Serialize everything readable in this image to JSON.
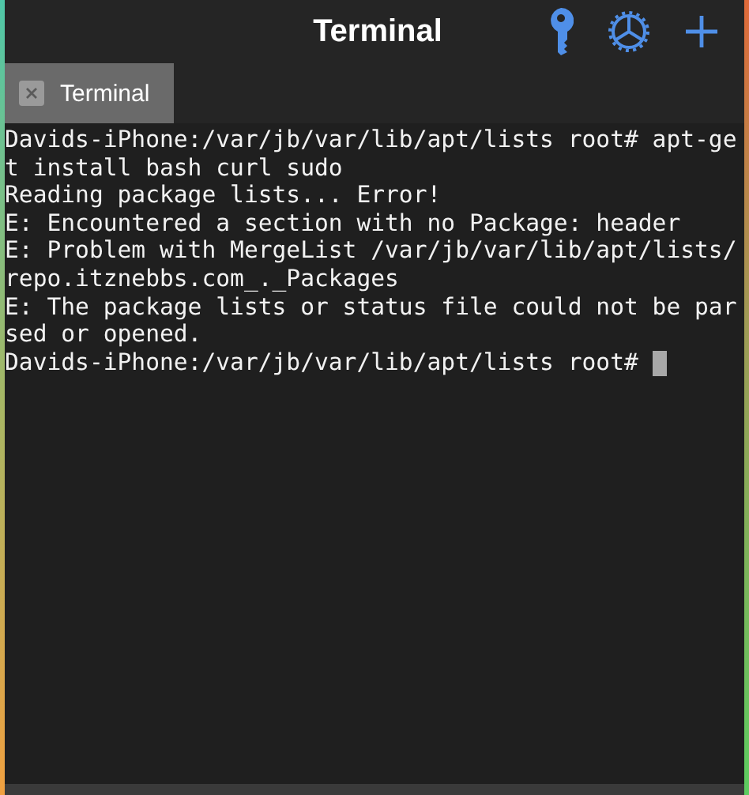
{
  "window": {
    "title": "Terminal"
  },
  "tabs": [
    {
      "label": "Terminal",
      "selected": true
    }
  ],
  "terminal": {
    "lines": [
      "Davids-iPhone:/var/jb/var/lib/apt/lists root# apt-ge",
      "t install bash curl sudo",
      "Reading package lists... Error!",
      "E: Encountered a section with no Package: header",
      "E: Problem with MergeList /var/jb/var/lib/apt/lists/",
      "repo.itznebbs.com_._Packages",
      "E: The package lists or status file could not be par",
      "sed or opened.",
      "Davids-iPhone:/var/jb/var/lib/apt/lists root# "
    ]
  }
}
